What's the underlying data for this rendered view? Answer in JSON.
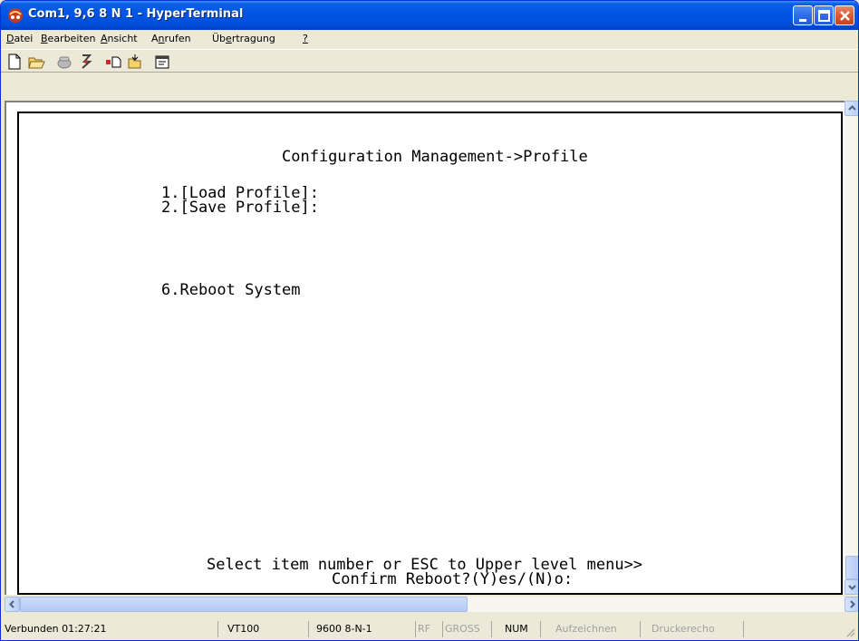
{
  "window": {
    "title": "Com1, 9,6 8 N 1 - HyperTerminal"
  },
  "menu": {
    "items": [
      {
        "accel": "D",
        "rest": "atei"
      },
      {
        "accel": "B",
        "rest": "earbeiten"
      },
      {
        "accel": "A",
        "rest": "nsicht"
      },
      {
        "pre": "A",
        "accel": "n",
        "rest": "rufen"
      },
      {
        "pre": "Üb",
        "accel": "e",
        "rest": "rtragung"
      },
      {
        "accel": "?",
        "rest": ""
      }
    ]
  },
  "toolbar": {
    "icons": [
      "new-document-icon",
      "open-folder-icon",
      "call-icon",
      "disconnect-icon",
      "send-icon",
      "receive-icon",
      "properties-icon"
    ]
  },
  "terminal": {
    "heading": "Configuration Management->Profile",
    "item1": "1.[Load Profile]:",
    "item2": "2.[Save Profile]:",
    "item6": "6.Reboot System",
    "prompt": "Select item number or ESC to Upper level menu>>",
    "confirm": "Confirm Reboot?(Y)es/(N)o:"
  },
  "status": {
    "connection": "Verbunden 01:27:21",
    "emulation": "VT100",
    "settings": "9600 8-N-1",
    "rf": "RF",
    "caps": "GROSS",
    "num": "NUM",
    "capture": "Aufzeichnen",
    "print_echo": "Druckerecho"
  },
  "colors": {
    "titlebar": "#0054e3",
    "window_bg": "#ece9d8",
    "terminal_bg": "#ffffff"
  }
}
